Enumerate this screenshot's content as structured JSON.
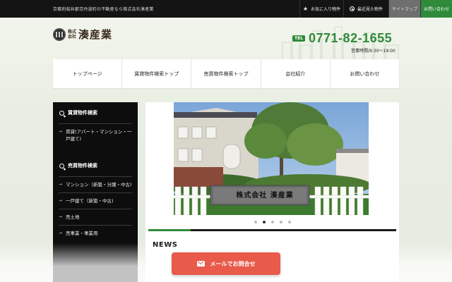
{
  "topbar": {
    "tagline": "京都府船井郡京丹波町の不動産なら株式会社湊産業",
    "favorites_label": "お気に入り物件",
    "favorites_icon": "star-icon",
    "recent_label": "最近見た物件",
    "recent_icon": "clock-icon",
    "sitemap_label": "サイトマップ",
    "contact_label": "お問い合わせ"
  },
  "header": {
    "logo_small_line1": "株式",
    "logo_small_line2": "会社",
    "logo_name": "湊産業",
    "tel_badge": "TEL",
    "tel_number": "0771-82-1655",
    "hours": "営業時間/9:30〜19:00"
  },
  "nav": {
    "items": [
      {
        "label": "トップページ"
      },
      {
        "label": "賃貸物件検索トップ"
      },
      {
        "label": "売買物件検索トップ"
      },
      {
        "label": "会社紹介"
      },
      {
        "label": "お問い合わせ"
      }
    ]
  },
  "sidebar": {
    "rental_heading": "賃貸物件検索",
    "rental_items": [
      {
        "label": "賃貸(アパート・マンション・一戸建て)"
      }
    ],
    "sale_heading": "売買物件検索",
    "sale_items": [
      {
        "label": "マンション（新築・分譲・中古)"
      },
      {
        "label": "一戸建て（新築・中古)"
      },
      {
        "label": "売土地"
      },
      {
        "label": "売事業・事業用"
      }
    ]
  },
  "slider": {
    "sign_text": "株式会社 湊産業",
    "dot_count": 5,
    "active_index": 1,
    "progress": 0.17
  },
  "news": {
    "title": "NEWS"
  },
  "mail_button": {
    "label": "メールでお問合せ",
    "icon": "mail-icon"
  },
  "colors": {
    "accent_green": "#2f8a3b",
    "mail_red": "#e85a4a",
    "topbar_bg": "#141414"
  }
}
